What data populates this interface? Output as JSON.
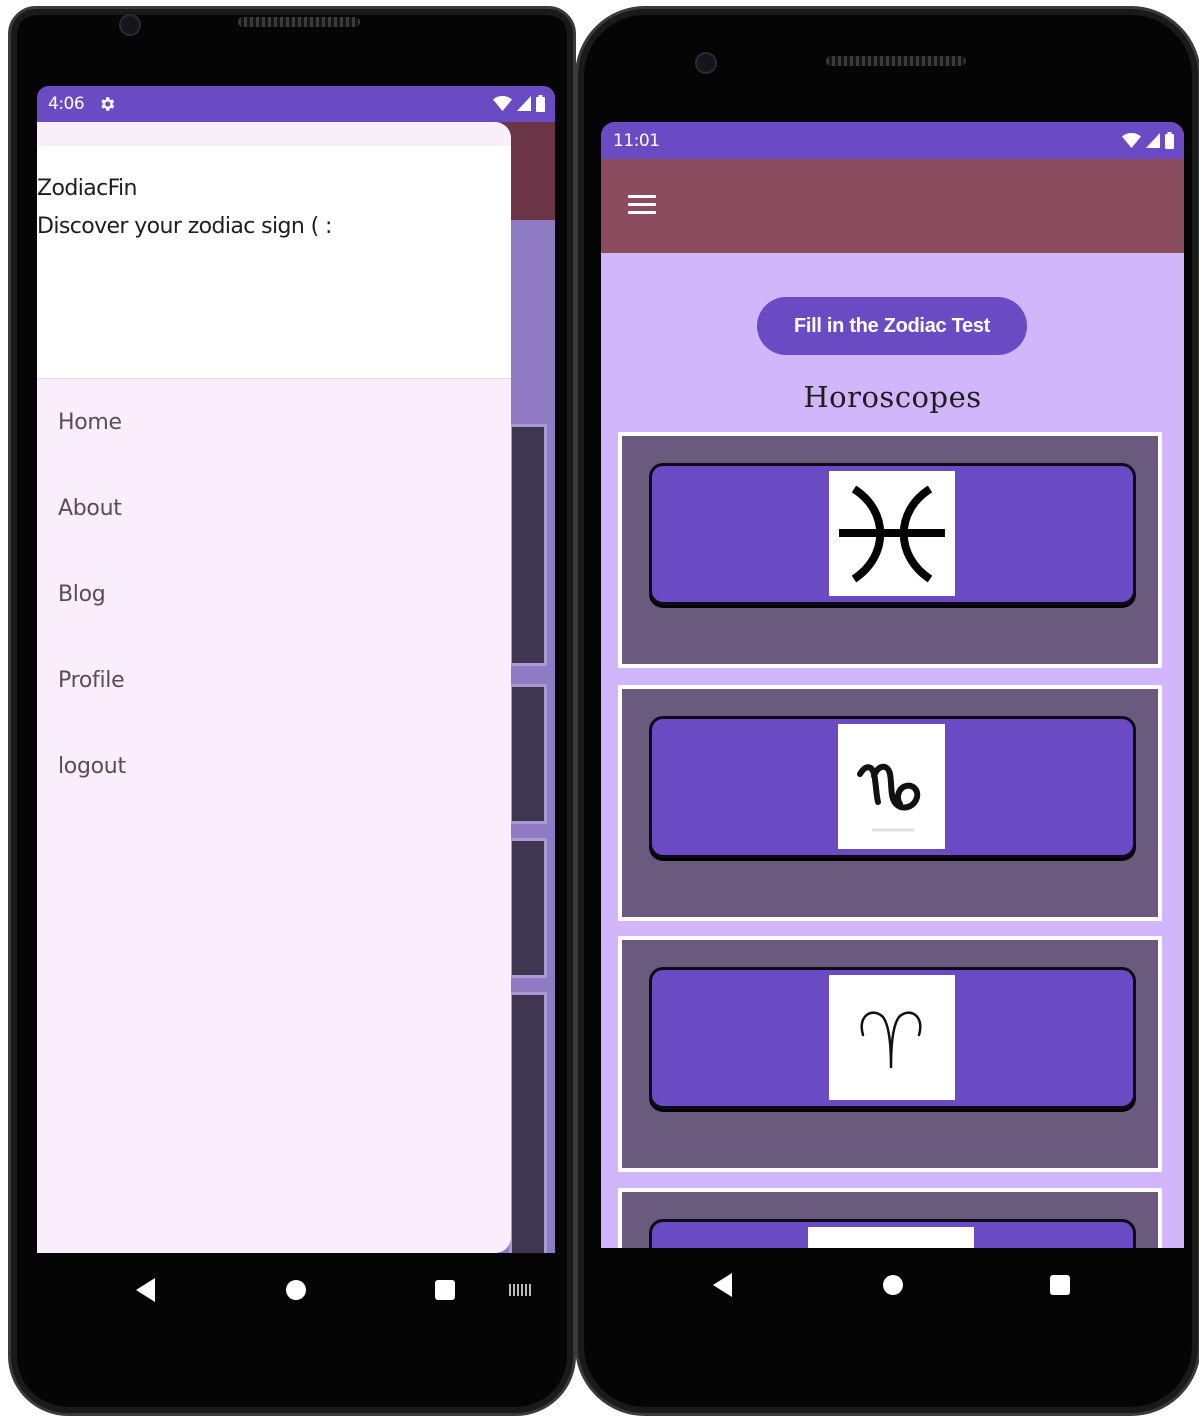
{
  "left_screen": {
    "status": {
      "time": "4:06"
    },
    "drawer": {
      "app_name": "ZodiacFin",
      "tagline": "Discover your zodiac sign ( :",
      "menu": [
        {
          "label": "Home"
        },
        {
          "label": "About"
        },
        {
          "label": "Blog"
        },
        {
          "label": "Profile"
        },
        {
          "label": "logout"
        }
      ]
    }
  },
  "right_screen": {
    "status": {
      "time": "11:01"
    },
    "cta_button": "Fill in the Zodiac Test",
    "section_title": "Horoscopes",
    "cards": [
      {
        "sign": "Pisces",
        "glyph": "pisces-symbol"
      },
      {
        "sign": "Capricorn",
        "glyph": "capricorn-symbol"
      },
      {
        "sign": "Aries",
        "glyph": "aries-symbol"
      },
      {
        "sign": "",
        "glyph": ""
      }
    ]
  },
  "colors": {
    "status_bar": "#6a4bc4",
    "drawer_bg": "#f8effb",
    "app_bar_right": "#8b4c5f",
    "app_bar_left": "#6b3447",
    "content_bg": "#d2b6fb",
    "card_outer": "#6a5b7e",
    "card_inner": "#6a4bc4"
  }
}
